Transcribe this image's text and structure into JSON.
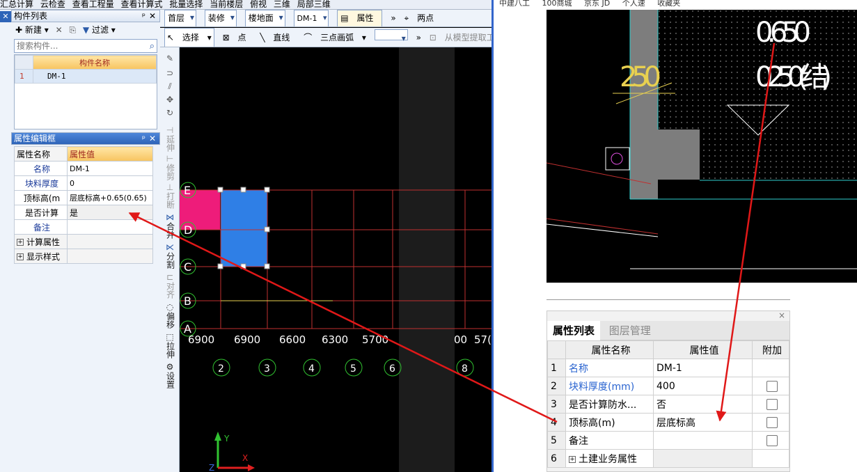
{
  "topbar": {
    "items": [
      "汇总计算",
      "云检查",
      "查看工程量",
      "查看计算式",
      "批量选择",
      "当前楼层",
      "俯视",
      "三维",
      "局部三维"
    ]
  },
  "left": {
    "component_panel_title": "构件列表",
    "new_label": "新建",
    "filter_label": "过滤",
    "search_placeholder": "搜索构件...",
    "list_header": "构件名称",
    "rows": [
      {
        "num": "1",
        "name": "DM-1"
      }
    ],
    "prop_panel_title": "属性编辑框",
    "prop_headers": [
      "属性名称",
      "属性值"
    ],
    "props": [
      {
        "name": "名称",
        "value": "DM-1"
      },
      {
        "name": "块料厚度",
        "value": "0"
      },
      {
        "name": "顶标高(m",
        "value": "层底标高+0.65(0.65)"
      },
      {
        "name": "是否计算",
        "value": "是"
      },
      {
        "name": "备注",
        "value": ""
      }
    ],
    "groups": [
      "计算属性",
      "显示样式"
    ]
  },
  "cad": {
    "toolbar1": {
      "floor": "首层",
      "category": "装修",
      "type": "楼地面",
      "comp": "DM-1",
      "prop_btn": "属性",
      "twopoint": "两点"
    },
    "toolbar2": {
      "select": "选择",
      "point": "点",
      "line": "直线",
      "arc": "三点画弧",
      "extract": "从模型提取工程量"
    },
    "vtools": [
      "延伸",
      "修剪",
      "打断",
      "合并",
      "分割",
      "对齐",
      "偏移",
      "拉伸",
      "设置"
    ],
    "axis_rows": [
      "E",
      "D",
      "C",
      "B",
      "A"
    ],
    "dims": [
      "6900",
      "6900",
      "6600",
      "6300",
      "5700",
      "00",
      "57("
    ],
    "axis_cols": [
      "2",
      "3",
      "4",
      "5",
      "6",
      "8"
    ],
    "ucs": {
      "y": "Y",
      "x": "X",
      "z": "Z"
    }
  },
  "right": {
    "topbar_items": [
      "中建八工",
      "100商城",
      "京东 JD",
      "个人速",
      "收藏夹"
    ],
    "cad_texts": {
      "t1": "0.650",
      "t2": "0.250(结)",
      "t3": "250"
    },
    "tabs": [
      "属性列表",
      "图层管理"
    ],
    "headers": [
      "",
      "属性名称",
      "属性值",
      "附加"
    ],
    "rows": [
      {
        "num": "1",
        "name": "名称",
        "value": "DM-1",
        "blue": true,
        "check": false
      },
      {
        "num": "2",
        "name": "块料厚度(mm)",
        "value": "400",
        "blue": true,
        "check": true
      },
      {
        "num": "3",
        "name": "是否计算防水...",
        "value": "否",
        "blue": false,
        "check": true
      },
      {
        "num": "4",
        "name": "顶标高(m)",
        "value": "层底标高",
        "blue": false,
        "check": true
      },
      {
        "num": "5",
        "name": "备注",
        "value": "",
        "blue": false,
        "check": true
      },
      {
        "num": "6",
        "name": "土建业务属性",
        "value": "",
        "blue": false,
        "check": false
      }
    ]
  },
  "colors": {
    "annotation_arrow": "#e01818",
    "cad_bg": "#000000",
    "grid_red": "#c03030",
    "blue_fill": "#2f7fe6",
    "pink_fill": "#ee1c7a"
  }
}
